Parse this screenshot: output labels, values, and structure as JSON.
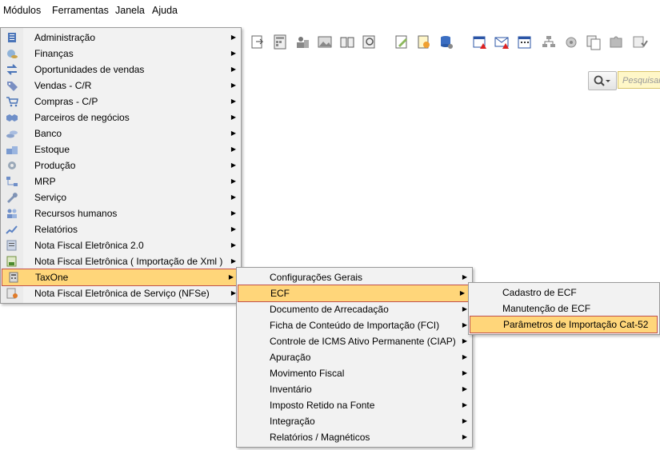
{
  "menubar": {
    "items": [
      {
        "label": "Módulos"
      },
      {
        "label": "Ferramentas"
      },
      {
        "label": "Janela"
      },
      {
        "label": "Ajuda"
      }
    ]
  },
  "search": {
    "placeholder": "Pesquisar"
  },
  "main_menu": {
    "items": [
      {
        "label": "Administração",
        "icon": "document-stack-icon"
      },
      {
        "label": "Finanças",
        "icon": "globe-coins-icon"
      },
      {
        "label": "Oportunidades de vendas",
        "icon": "trend-arrows-icon"
      },
      {
        "label": "Vendas - C/R",
        "icon": "tag-icon"
      },
      {
        "label": "Compras - C/P",
        "icon": "cart-icon"
      },
      {
        "label": "Parceiros de negócios",
        "icon": "handshake-icon"
      },
      {
        "label": "Banco",
        "icon": "bank-coins-icon"
      },
      {
        "label": "Estoque",
        "icon": "boxes-icon"
      },
      {
        "label": "Produção",
        "icon": "gear-icon"
      },
      {
        "label": "MRP",
        "icon": "flowchart-icon"
      },
      {
        "label": "Serviço",
        "icon": "wrench-icon"
      },
      {
        "label": "Recursos humanos",
        "icon": "people-icon"
      },
      {
        "label": "Relatórios",
        "icon": "chart-icon"
      },
      {
        "label": "Nota Fiscal Eletrônica 2.0",
        "icon": "invoice-icon"
      },
      {
        "label": "Nota Fiscal Eletrônica ( Importação de Xml )",
        "icon": "xml-invoice-icon"
      },
      {
        "label": "TaxOne",
        "icon": "calculator-icon"
      },
      {
        "label": "Nota Fiscal Eletrônica de Serviço (NFSe)",
        "icon": "service-invoice-icon"
      }
    ]
  },
  "taxone_menu": {
    "items": [
      {
        "label": "Configurações Gerais"
      },
      {
        "label": "ECF"
      },
      {
        "label": "Documento de Arrecadação"
      },
      {
        "label": "Ficha de Conteúdo de Importação (FCI)"
      },
      {
        "label": "Controle de ICMS Ativo Permanente (CIAP)"
      },
      {
        "label": "Apuração"
      },
      {
        "label": "Movimento Fiscal"
      },
      {
        "label": "Inventário"
      },
      {
        "label": "Imposto Retido na Fonte"
      },
      {
        "label": "Integração"
      },
      {
        "label": "Relatórios / Magnéticos"
      }
    ]
  },
  "ecf_menu": {
    "items": [
      {
        "label": "Cadastro de ECF"
      },
      {
        "label": "Manutenção de ECF"
      },
      {
        "label": "Parâmetros de Importação Cat-52"
      }
    ]
  },
  "colors": {
    "highlight": "#ffd67a",
    "highlight_border": "#c0504d"
  }
}
